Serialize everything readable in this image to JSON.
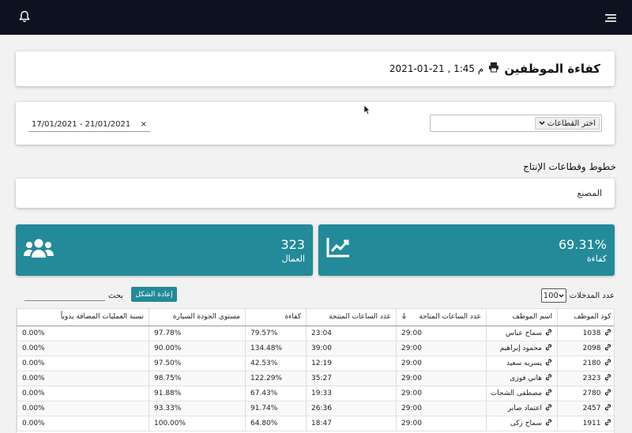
{
  "header": {
    "bell_icon": "bell-icon",
    "menu_icon": "hamburger-menu-icon"
  },
  "title": {
    "text": "كفاءة الموظفين",
    "date": "2021-01-21 , 1:45 م",
    "print_icon": "printer-icon"
  },
  "filters": {
    "sector_label": "اختر القطاعات",
    "date_range": "17/01/2021 - 21/01/2021",
    "clear": "×"
  },
  "section": {
    "title": "خطوط وقطاعات الإنتاج",
    "factory": "المصنع"
  },
  "stats": {
    "efficiency": {
      "value": "69.31%",
      "label": "كفاءة",
      "icon": "chart-line-icon"
    },
    "workers": {
      "value": "323",
      "label": "العمال",
      "icon": "users-icon"
    }
  },
  "controls": {
    "entries_label": "عدد المدخلات",
    "entries_value": "100",
    "reset": "إعادة الشكل",
    "search_label": "بحث"
  },
  "table": {
    "headers": [
      "كود الموظف",
      "اسم الموظف",
      "عدد الساعات المتاحة",
      "عدد الساعات المنتجة",
      "كفاءة",
      "مستوي الجودة السيارة",
      "نسبة العمليات المضافة يدوياً"
    ],
    "rows": [
      [
        "1038",
        "سماح عباس",
        "29:00",
        "23:04",
        "79.57%",
        "97.78%",
        "0.00%"
      ],
      [
        "2098",
        "محمود إبراهيم",
        "29:00",
        "39:00",
        "134.48%",
        "90.00%",
        "0.00%"
      ],
      [
        "2180",
        "يسريه سعيد",
        "29:00",
        "12:19",
        "42.53%",
        "97.50%",
        "0.00%"
      ],
      [
        "2323",
        "هاني فوزى",
        "29:00",
        "35:27",
        "122.29%",
        "98.75%",
        "0.00%"
      ],
      [
        "2780",
        "مصطفى الشحات",
        "29:00",
        "19:33",
        "67.43%",
        "91.88%",
        "0.00%"
      ],
      [
        "2457",
        "اعتماد صابر",
        "29:00",
        "26:36",
        "91.74%",
        "93.33%",
        "0.00%"
      ],
      [
        "1911",
        "سماح زكى",
        "29:00",
        "18:47",
        "64.80%",
        "100.00%",
        "0.00%"
      ]
    ]
  }
}
